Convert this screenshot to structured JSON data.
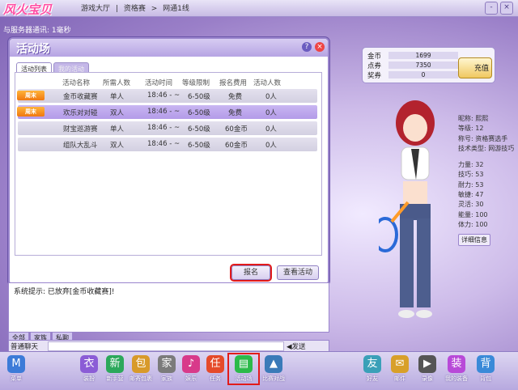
{
  "app": {
    "logo": "风火宝贝",
    "crumbs": [
      "游戏大厅",
      "资格赛",
      "网通1线"
    ],
    "room_line": "与服务器通讯: 1毫秒"
  },
  "window_buttons": [
    "-",
    "×"
  ],
  "panel": {
    "title": "活动场",
    "help": "?",
    "close": "×",
    "tabs": [
      "活动列表",
      "我的活动"
    ],
    "headers": [
      "活动名称",
      "所需人数",
      "活动时间",
      "等级限制",
      "报名费用",
      "活动人数"
    ],
    "rows": [
      {
        "tag": "周末",
        "name": "金币收藏赛",
        "people": "单人",
        "time": "18:46 - ~",
        "level": "6-50级",
        "fee": "免费",
        "count": "0人"
      },
      {
        "tag": "周末",
        "name": "欢乐对对碰",
        "people": "双人",
        "time": "18:46 - ~",
        "level": "6-50级",
        "fee": "免费",
        "count": "0人"
      },
      {
        "tag": "",
        "name": "财宝巡游赛",
        "people": "单人",
        "time": "18:46 - ~",
        "level": "6-50级",
        "fee": "60金币",
        "count": "0人"
      },
      {
        "tag": "",
        "name": "组队大乱斗",
        "people": "双人",
        "time": "18:46 - ~",
        "level": "6-50级",
        "fee": "60金币",
        "count": "0人"
      }
    ],
    "selected_row": 1,
    "signup": "报名",
    "view": "查看活动"
  },
  "chat": {
    "message": "系统提示: 已放弃[金币收藏赛]!",
    "tabs": [
      "全部",
      "家族",
      "私聊"
    ],
    "channel": "普通聊天",
    "send": "◀发送"
  },
  "currency": [
    {
      "label": "金币",
      "value": "1699"
    },
    {
      "label": "点券",
      "value": "7350"
    },
    {
      "label": "奖券",
      "value": "0"
    }
  ],
  "recharge": "充值",
  "profile": [
    "昵称: 熙熙",
    "等级: 12",
    "称号: 资格赛选手",
    "技术类型: 网游技巧",
    "力量: 32",
    "技巧: 53",
    "耐力: 53",
    "敏捷: 47",
    "灵活: 30",
    "能量: 100",
    "体力: 100"
  ],
  "detail": "详细信息",
  "bottom_icons": [
    {
      "label": "菜单",
      "icon": "menu-icon",
      "color": "#3c7bd8",
      "glyph": "M"
    },
    {
      "label": "装扮",
      "icon": "dress-icon",
      "color": "#8b5cd6",
      "glyph": "衣"
    },
    {
      "label": "新手营",
      "icon": "camp-icon",
      "color": "#2ca85b",
      "glyph": "新"
    },
    {
      "label": "邮寄包裹",
      "icon": "package-icon",
      "color": "#d89a2a",
      "glyph": "包"
    },
    {
      "label": "家族",
      "icon": "house-icon",
      "color": "#7b7b7b",
      "glyph": "家"
    },
    {
      "label": "娱乐",
      "icon": "music-icon",
      "color": "#d83a8a",
      "glyph": "♪"
    },
    {
      "label": "任务",
      "icon": "task-icon",
      "color": "#e54a2a",
      "glyph": "任"
    },
    {
      "label": "活动场",
      "icon": "activity-icon",
      "color": "#2cba4a",
      "glyph": "▤"
    },
    {
      "label": "比赛对战",
      "icon": "battle-icon",
      "color": "#3a7ab8",
      "glyph": "▲"
    },
    {
      "label": "好友",
      "icon": "friends-icon",
      "color": "#3aa0b8",
      "glyph": "友"
    },
    {
      "label": "邮件",
      "icon": "mail-icon",
      "color": "#d8a02a",
      "glyph": "✉"
    },
    {
      "label": "录像",
      "icon": "video-icon",
      "color": "#555",
      "glyph": "▶"
    },
    {
      "label": "我的装备",
      "icon": "gear-icon",
      "color": "#b84ad8",
      "glyph": "装"
    },
    {
      "label": "背包",
      "icon": "bag-icon",
      "color": "#3a8ad8",
      "glyph": "背"
    }
  ],
  "colors": {
    "accent": "#9a85cd",
    "highlight": "#e21b1b",
    "tag": "#f07810"
  }
}
